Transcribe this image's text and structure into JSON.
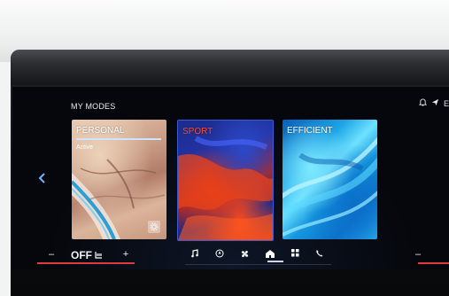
{
  "header": {
    "title": "MY MODES",
    "status_letter": "E"
  },
  "modes": [
    {
      "label": "PERSONAL",
      "sublabel": "Active",
      "selected": true
    },
    {
      "label": "SPORT",
      "label_color": "#ff4b2b"
    },
    {
      "label": "EFFICIENT"
    }
  ],
  "climate_left": {
    "minus": "–",
    "value": "OFF",
    "plus": "+"
  },
  "climate_right": {
    "minus": "–"
  },
  "dock": {
    "items": [
      "music-icon",
      "navigation-icon",
      "fan-icon",
      "home-icon",
      "apps-icon",
      "phone-icon"
    ],
    "active": "home-icon"
  },
  "colors": {
    "accent": "#3b5bd6",
    "sport": "#ff4b2b",
    "heat_bar": "#e0393e"
  }
}
